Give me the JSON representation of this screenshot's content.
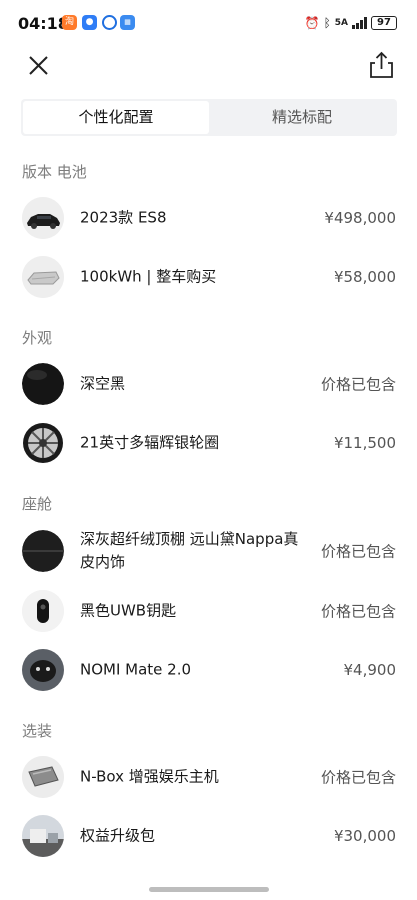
{
  "status_bar": {
    "time": "04:18",
    "battery": "97",
    "network": "5A"
  },
  "tabs": [
    {
      "label": "个性化配置",
      "active": true
    },
    {
      "label": "精选标配",
      "active": false
    }
  ],
  "sections": [
    {
      "title": "版本 电池",
      "items": [
        {
          "name": "2023款 ES8",
          "price": "¥498,000",
          "thumb": "car"
        },
        {
          "name": "100kWh | 整车购买",
          "price": "¥58,000",
          "thumb": "battery"
        }
      ]
    },
    {
      "title": "外观",
      "items": [
        {
          "name": "深空黑",
          "price": "价格已包含",
          "thumb": "black-paint"
        },
        {
          "name": "21英寸多辐辉银轮圈",
          "price": "¥11,500",
          "thumb": "wheel"
        }
      ]
    },
    {
      "title": "座舱",
      "items": [
        {
          "name": "深灰超纤绒顶棚 远山黛Nappa真皮内饰",
          "price": "价格已包含",
          "thumb": "interior"
        },
        {
          "name": "黑色UWB钥匙",
          "price": "价格已包含",
          "thumb": "key"
        },
        {
          "name": "NOMI Mate 2.0",
          "price": "¥4,900",
          "thumb": "nomi"
        }
      ]
    },
    {
      "title": "选装",
      "items": [
        {
          "name": "N-Box 增强娱乐主机",
          "price": "价格已包含",
          "thumb": "nbox"
        },
        {
          "name": "权益升级包",
          "price": "¥30,000",
          "thumb": "package"
        }
      ]
    }
  ]
}
